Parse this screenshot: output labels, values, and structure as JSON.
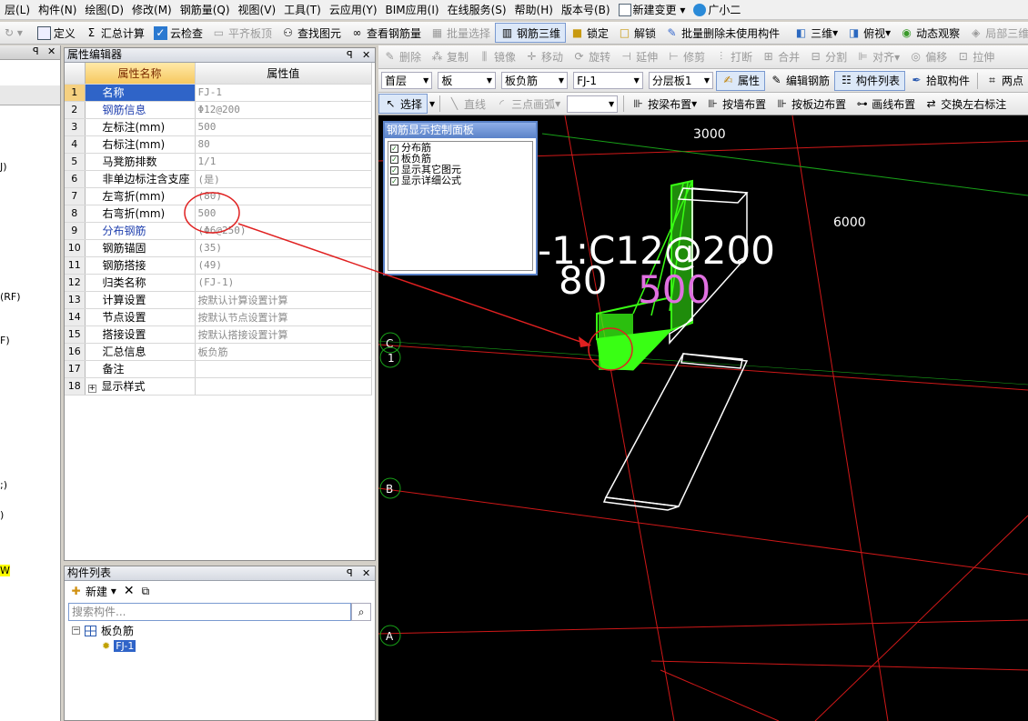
{
  "menu": [
    "层(L)",
    "构件(N)",
    "绘图(D)",
    "修改(M)",
    "钢筋量(Q)",
    "视图(V)",
    "工具(T)",
    "云应用(Y)",
    "BIM应用(I)",
    "在线服务(S)",
    "帮助(H)",
    "版本号(B)"
  ],
  "menu_extra": {
    "new_change": "新建变更",
    "assistant": "广小二"
  },
  "toolbar1": [
    "定义",
    "汇总计算",
    "云检查",
    "平齐板顶",
    "查找图元",
    "查看钢筋量",
    "批量选择",
    "钢筋三维",
    "锁定",
    "解锁",
    "批量删除未使用构件",
    "三维",
    "俯视",
    "动态观察",
    "局部三维"
  ],
  "toolbar2": [
    "删除",
    "复制",
    "镜像",
    "移动",
    "旋转",
    "延伸",
    "修剪",
    "打断",
    "合并",
    "分割",
    "对齐",
    "偏移",
    "拉伸"
  ],
  "toolbar3": {
    "floor": "首层",
    "type": "板",
    "subtype": "板负筋",
    "component": "FJ-1",
    "layer": "分层板1",
    "buttons": [
      "属性",
      "编辑钢筋",
      "构件列表",
      "拾取构件",
      "两点"
    ]
  },
  "toolbar4": [
    "选择",
    "直线",
    "三点画弧",
    "按梁布置",
    "按墙布置",
    "按板边布置",
    "画线布置",
    "交换左右标注"
  ],
  "left_strip": [
    "J)",
    "(RF)",
    "F)",
    ";)",
    ")",
    "W"
  ],
  "property_editor": {
    "title": "属性编辑器",
    "col_name": "属性名称",
    "col_value": "属性值",
    "rows": [
      {
        "num": "1",
        "name": "名称",
        "value": "FJ-1"
      },
      {
        "num": "2",
        "name": "钢筋信息",
        "value": "Φ12@200"
      },
      {
        "num": "3",
        "name": "左标注(mm)",
        "value": "500"
      },
      {
        "num": "4",
        "name": "右标注(mm)",
        "value": "80"
      },
      {
        "num": "5",
        "name": "马凳筋排数",
        "value": "1/1"
      },
      {
        "num": "6",
        "name": "非单边标注含支座",
        "value": "(是)"
      },
      {
        "num": "7",
        "name": "左弯折(mm)",
        "value": "(80)"
      },
      {
        "num": "8",
        "name": "右弯折(mm)",
        "value": "500"
      },
      {
        "num": "9",
        "name": "分布钢筋",
        "value": "(Φ6@250)"
      },
      {
        "num": "10",
        "name": "钢筋锚固",
        "value": "(35)"
      },
      {
        "num": "11",
        "name": "钢筋搭接",
        "value": "(49)"
      },
      {
        "num": "12",
        "name": "归类名称",
        "value": "(FJ-1)"
      },
      {
        "num": "13",
        "name": "计算设置",
        "value": "按默认计算设置计算"
      },
      {
        "num": "14",
        "name": "节点设置",
        "value": "按默认节点设置计算"
      },
      {
        "num": "15",
        "name": "搭接设置",
        "value": "按默认搭接设置计算"
      },
      {
        "num": "16",
        "name": "汇总信息",
        "value": "板负筋"
      },
      {
        "num": "17",
        "name": "备注",
        "value": ""
      },
      {
        "num": "18",
        "name": "显示样式",
        "value": ""
      }
    ]
  },
  "rebar_panel": {
    "title": "钢筋显示控制面板",
    "items": [
      "分布筋",
      "板负筋",
      "显示其它图元",
      "显示详细公式"
    ]
  },
  "component_list": {
    "title": "构件列表",
    "new_label": "新建",
    "search_placeholder": "搜索构件...",
    "tree_root": "板负筋",
    "tree_child": "FJ-1"
  },
  "canvas": {
    "dim_top": "3000",
    "dim_right": "6000",
    "label_line1": "-1:C12@200",
    "label_line2": "80",
    "label_line3": "500",
    "axis_c": "C",
    "axis_1": "1",
    "axis_b": "B",
    "axis_a": "A"
  },
  "colors": {
    "canvas_bg": "#000000",
    "red_line": "#d01818",
    "green_line": "#18a018",
    "rebar_green": "#39ff14",
    "label_pink": "#e070e0",
    "annotation_red": "#e02020"
  }
}
